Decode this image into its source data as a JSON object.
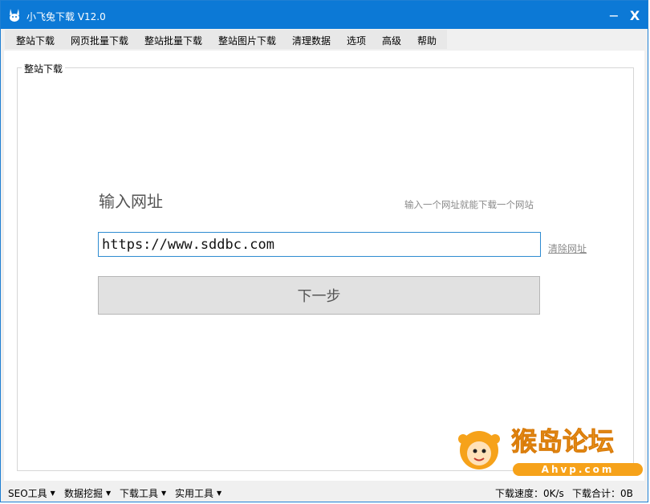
{
  "window": {
    "title": "小飞兔下载 V12.0",
    "minimize_glyph": "−",
    "close_glyph": "X",
    "accent": "#0c79d6"
  },
  "menu": {
    "items": [
      "整站下载",
      "网页批量下载",
      "整站批量下载",
      "整站图片下载",
      "清理数据",
      "选项",
      "高级",
      "帮助"
    ]
  },
  "groupbox": {
    "label": "整站下载"
  },
  "main": {
    "heading": "输入网址",
    "hint": "输入一个网址就能下载一个网站",
    "url_value": "https://www.sddbc.com",
    "clear_label": "清除网址",
    "next_label": "下一步"
  },
  "watermark": {
    "text": "猴岛论坛",
    "subtext": "Ahvp.com"
  },
  "statusbar": {
    "menus": [
      "SEO工具",
      "数据挖掘",
      "下载工具",
      "实用工具"
    ],
    "caret": "▼",
    "speed": "下载速度：0K/s",
    "total": "下载合计：0B"
  }
}
